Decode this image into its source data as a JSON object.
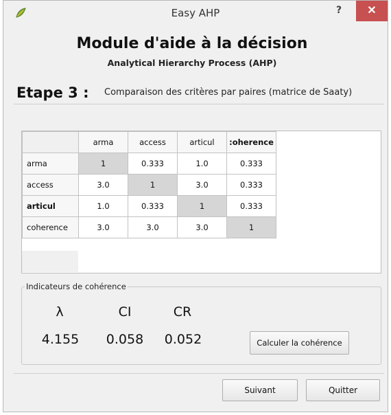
{
  "window": {
    "title": "Easy AHP",
    "help_label": "?",
    "close_label": "✕"
  },
  "header": {
    "title": "Module d'aide à la décision",
    "subtitle": "Analytical Hierarchy Process (AHP)"
  },
  "step": {
    "label": "Etape 3 :",
    "description": "Comparaison des critères par paires (matrice de Saaty)"
  },
  "matrix": {
    "columns": [
      "arma",
      "access",
      "articul",
      ":oherence"
    ],
    "rows": [
      {
        "label": "arma",
        "values": [
          "1",
          "0.333",
          "1.0",
          "0.333"
        ]
      },
      {
        "label": "access",
        "values": [
          "3.0",
          "1",
          "3.0",
          "0.333"
        ]
      },
      {
        "label": "articul",
        "values": [
          "1.0",
          "0.333",
          "1",
          "0.333"
        ]
      },
      {
        "label": "coherence",
        "values": [
          "3.0",
          "3.0",
          "3.0",
          "1"
        ]
      }
    ]
  },
  "indicators": {
    "group_title": "Indicateurs de cohérence",
    "lambda_label": "λ",
    "ci_label": "CI",
    "cr_label": "CR",
    "lambda_value": "4.155",
    "ci_value": "0.058",
    "cr_value": "0.052",
    "calc_button": "Calculer la cohérence"
  },
  "footer": {
    "next_button": "Suivant",
    "quit_button": "Quitter"
  }
}
